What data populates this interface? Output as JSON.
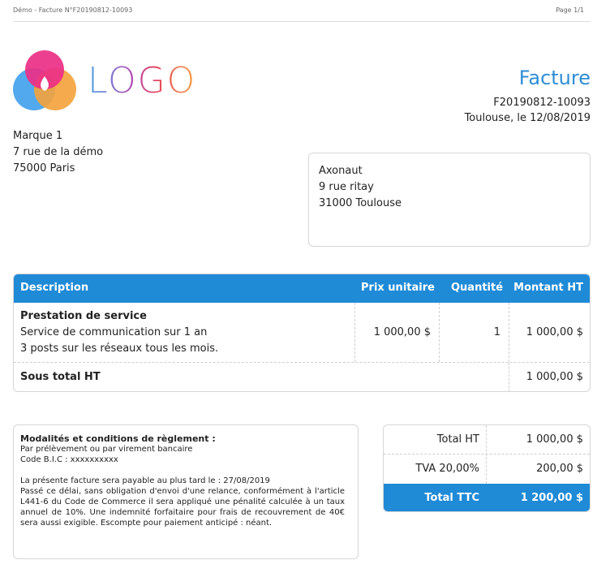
{
  "page_header": {
    "left": "Démo - Facture N°F20190812-10093",
    "right": "Page 1/1"
  },
  "logo": {
    "text": "LOGO"
  },
  "document": {
    "title": "Facture",
    "number": "F20190812-10093",
    "place_date": "Toulouse, le 12/08/2019"
  },
  "sender": {
    "name": "Marque 1",
    "street": "7 rue de la démo",
    "city": "75000 Paris"
  },
  "client": {
    "name": "Axonaut",
    "street": "9 rue ritay",
    "city": "31000 Toulouse"
  },
  "items_table": {
    "headers": {
      "description": "Description",
      "unit_price": "Prix unitaire",
      "quantity": "Quantité",
      "amount": "Montant HT"
    },
    "rows": [
      {
        "title": "Prestation de service",
        "line1": "Service de communication sur 1 an",
        "line2": "3 posts sur les réseaux tous les mois.",
        "unit_price": "1 000,00 $",
        "quantity": "1",
        "amount": "1 000,00 $"
      }
    ],
    "subtotal_label": "Sous total HT",
    "subtotal_value": "1 000,00 $"
  },
  "terms": {
    "title": "Modalités et conditions de règlement :",
    "line1": "Par prélèvement ou par virement bancaire",
    "line2": "Code B.I.C : xxxxxxxxxx",
    "due": "La présente facture sera payable au plus tard le : 27/08/2019",
    "penalty": "Passé ce délai, sans obligation d'envoi d'une relance, conformément à l'article L441-6 du Code de Commerce il sera appliqué une pénalité calculée à un taux annuel de 10%. Une indemnité forfaitaire pour frais de recouvrement de 40€ sera aussi exigible. Escompte pour paiement anticipé : néant."
  },
  "totals": {
    "ht_label": "Total HT",
    "ht_value": "1 000,00 $",
    "tva_label": "TVA 20,00%",
    "tva_value": "200,00 $",
    "ttc_label": "Total TTC",
    "ttc_value": "1 200,00 $"
  },
  "colors": {
    "accent": "#1f8ad6",
    "title": "#2d8ed7"
  }
}
